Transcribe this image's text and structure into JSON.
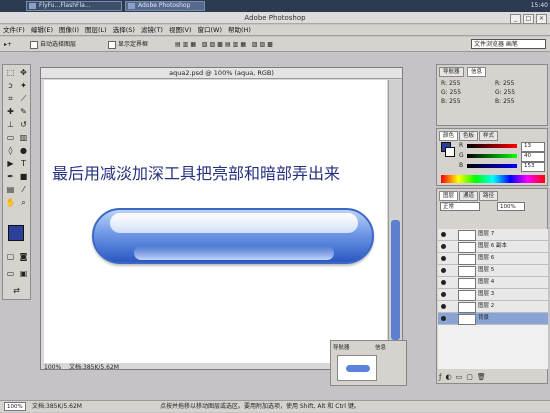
{
  "taskbar": {
    "tabs": [
      "FlyFu...FlashFla...",
      "Adobe Photoshop"
    ],
    "clock": "15:40"
  },
  "window": {
    "title": "Adobe Photoshop"
  },
  "menu": [
    "文件(F)",
    "编辑(E)",
    "图像(I)",
    "图层(L)",
    "选择(S)",
    "滤镜(T)",
    "视图(V)",
    "窗口(W)",
    "帮助(H)"
  ],
  "options": {
    "auto_select": "自动选择图层",
    "show_bounds": "显示定界框",
    "workspace_label": "文件浏览器 画笔"
  },
  "document": {
    "title": "aqua2.psd @ 100% (aqua, RGB)",
    "caption": "最后用减淡加深工具把亮部和暗部弄出来",
    "zoom": "100%",
    "doc_size": "文档:385K/5.62M"
  },
  "navigator": {
    "tabs": [
      "导航器",
      "信息"
    ]
  },
  "color_panel": {
    "tabs": [
      "颜色",
      "色板",
      "样式"
    ],
    "fields": [
      {
        "label": "R",
        "value": "13"
      },
      {
        "label": "G",
        "value": "40"
      },
      {
        "label": "B",
        "value": "153"
      }
    ]
  },
  "info_panel": {
    "rows": [
      {
        "label": "R:",
        "value": "255"
      },
      {
        "label": "G:",
        "value": "255"
      },
      {
        "label": "B:",
        "value": "255"
      }
    ]
  },
  "layers": {
    "tabs": [
      "图层",
      "通道",
      "路径"
    ],
    "mode": "正常",
    "opacity": "100%",
    "items": [
      "图层 7",
      "图层 6 副本",
      "图层 6",
      "图层 5",
      "图层 4",
      "图层 3",
      "图层 2",
      "背景"
    ]
  },
  "statusbar": {
    "zoom": "100%",
    "doc_size": "文档:385K/5.62M",
    "hint": "点按并拖移以移动图层或选区。要用附加选项，使用 Shift, Alt 和 Ctrl 键。"
  },
  "colors": {
    "foreground": "#2c3f99",
    "pill_top": "#bcd3f8",
    "pill_bottom": "#2b58c3",
    "caption": "#25317f"
  }
}
